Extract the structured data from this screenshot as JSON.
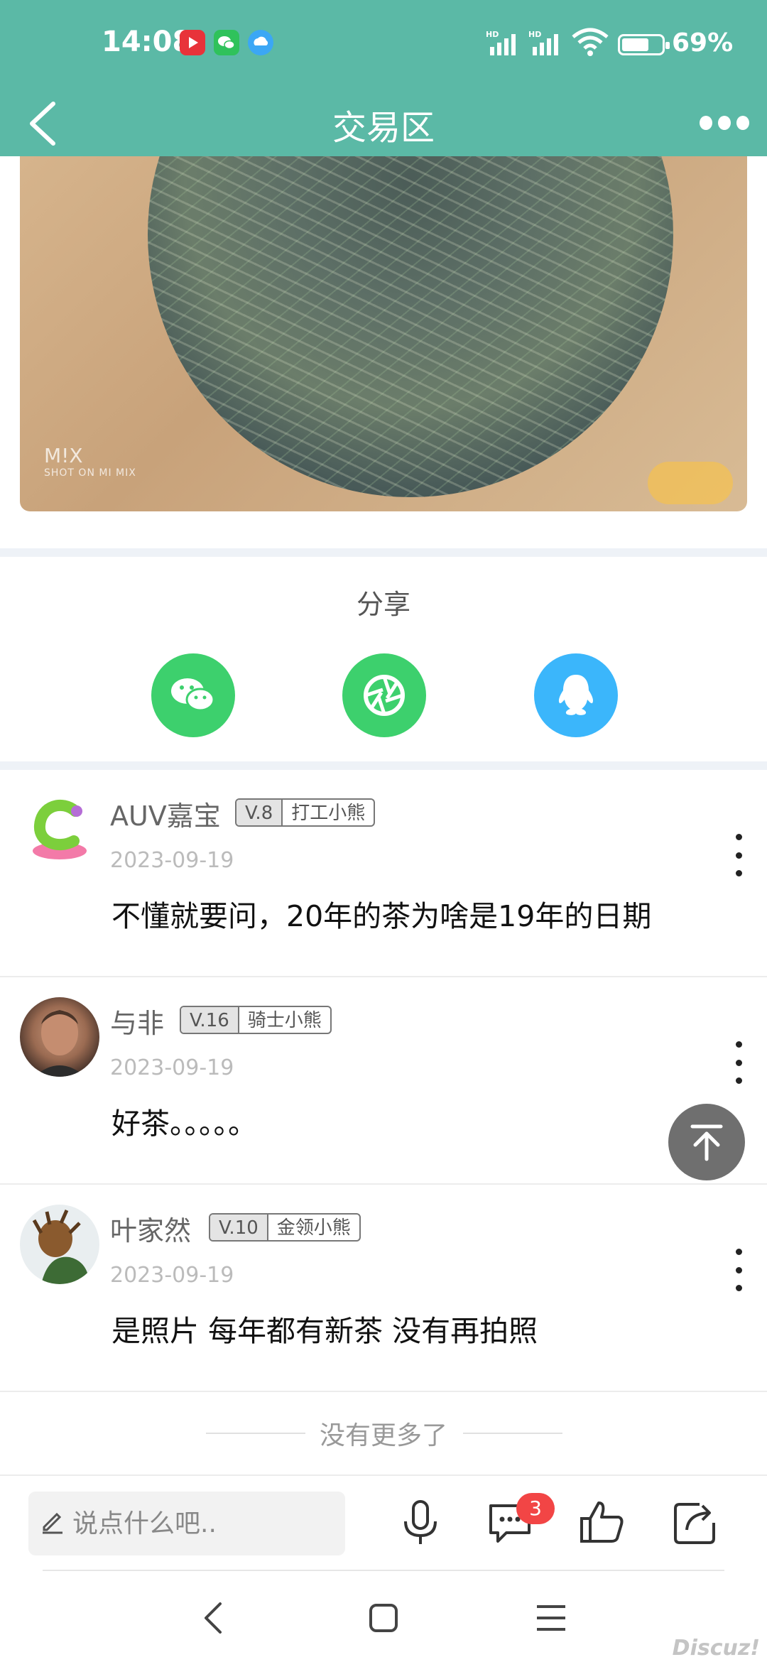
{
  "status_bar": {
    "time": "14:08",
    "battery": "69%",
    "battery_level": 0.69,
    "signal_labels": [
      "HD",
      "HD"
    ]
  },
  "header": {
    "title": "交易区"
  },
  "photo": {
    "watermark_brand": "M!X",
    "watermark_line": "SHOT ON MI MIX"
  },
  "share": {
    "title": "分享",
    "targets": [
      "wechat",
      "moments",
      "qq"
    ],
    "colors": {
      "wechat": "#3dd06d",
      "moments": "#3dd06d",
      "qq": "#3bb6fb"
    }
  },
  "comments": [
    {
      "user": "AUV嘉宝",
      "level": "V.8",
      "rank": "打工小熊",
      "date": "2023-09-19",
      "text": "不懂就要问，20年的茶为啥是19年的日期"
    },
    {
      "user": "与非",
      "level": "V.16",
      "rank": "骑士小熊",
      "date": "2023-09-19",
      "text": "好茶。。。。。"
    },
    {
      "user": "叶家然",
      "level": "V.10",
      "rank": "金领小熊",
      "date": "2023-09-19",
      "text": "是照片 每年都有新茶 没有再拍照"
    }
  ],
  "footer_note": "没有更多了",
  "toolbar": {
    "placeholder": "说点什么吧..",
    "comment_count": "3"
  },
  "watermark": "Discuz!",
  "theme": {
    "accent": "#5bb9a6",
    "badge_red": "#f24545"
  }
}
